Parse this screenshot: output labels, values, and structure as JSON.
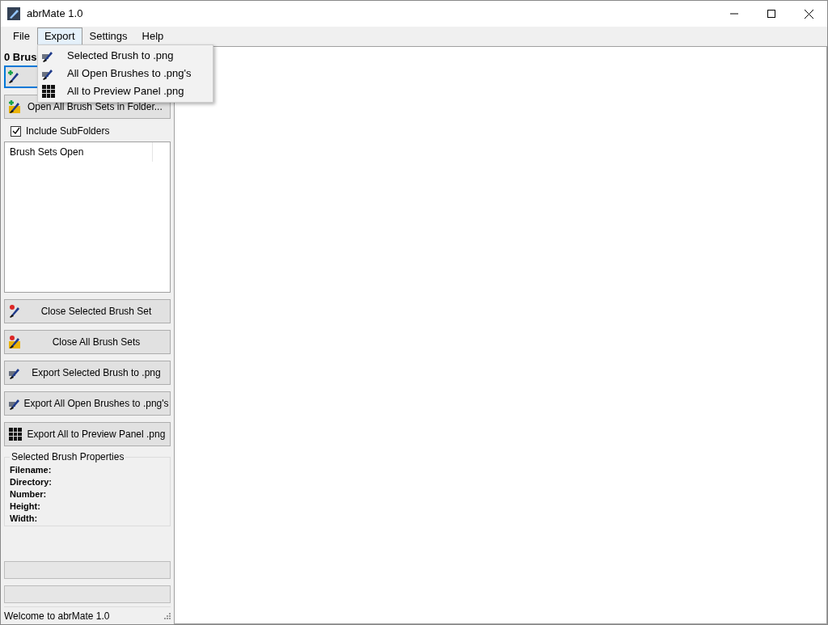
{
  "window": {
    "title": "abrMate 1.0"
  },
  "menu_bar": [
    {
      "label": "File",
      "selected": false
    },
    {
      "label": "Export",
      "selected": true
    },
    {
      "label": "Settings",
      "selected": false
    },
    {
      "label": "Help",
      "selected": false
    }
  ],
  "export_menu": [
    {
      "label": "Selected Brush to .png",
      "kind": "export"
    },
    {
      "label": "All Open Brushes to .png's",
      "kind": "export"
    },
    {
      "label": "All to Preview Panel .png",
      "kind": "grid"
    }
  ],
  "brush_count": "0 Brus",
  "open_button": {
    "focused": true
  },
  "open_folder_button": {
    "label": "Open All Brush Sets in Folder..."
  },
  "include_subfolders": {
    "label": "Include SubFolders",
    "checked": true
  },
  "brush_sets_list": {
    "column": "Brush Sets Open"
  },
  "action_buttons": [
    {
      "label": "Close Selected Brush Set",
      "kind": "remove"
    },
    {
      "label": "Close All Brush Sets",
      "kind": "folder-remove"
    },
    {
      "label": "Export Selected Brush to .png",
      "kind": "export"
    },
    {
      "label": "Export All Open Brushes to .png's",
      "kind": "export"
    },
    {
      "label": "Export All to Preview Panel .png",
      "kind": "grid"
    }
  ],
  "properties": {
    "title": "Selected Brush Properties",
    "fields": [
      "Filename:",
      "Directory:",
      "Number:",
      "Height:",
      "Width:"
    ]
  },
  "status_bar": "Welcome to abrMate 1.0"
}
